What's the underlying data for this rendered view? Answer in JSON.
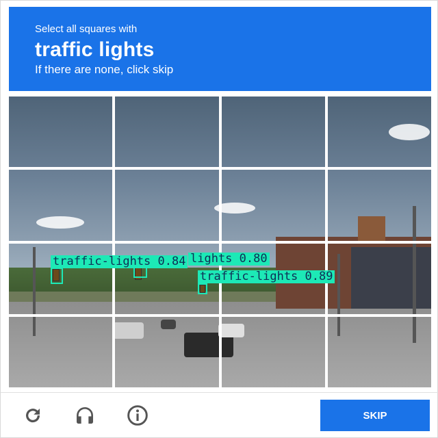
{
  "header": {
    "subtitle": "Select all squares with",
    "target": "traffic lights",
    "hint": "If there are none, click skip"
  },
  "grid": {
    "rows": 4,
    "cols": 4
  },
  "detections": [
    {
      "label": "traffic-lights 0.84"
    },
    {
      "label": "lights 0.80"
    },
    {
      "label": "traffic-lights 0.89"
    }
  ],
  "footer": {
    "reload_icon": "reload-icon",
    "audio_icon": "headphones-icon",
    "info_icon": "info-icon",
    "skip_label": "SKIP"
  },
  "colors": {
    "brand": "#1a73e8",
    "detection": "#1de9b6"
  }
}
